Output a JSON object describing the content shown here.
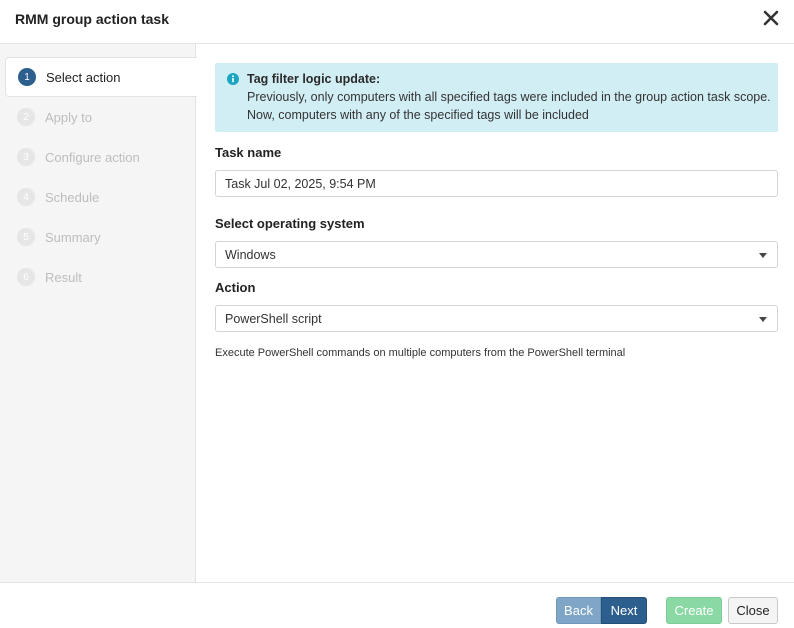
{
  "dialog": {
    "title": "RMM group action task",
    "close_icon": "close-x-icon"
  },
  "steps": [
    {
      "number": "1",
      "label": "Select action",
      "active": true
    },
    {
      "number": "2",
      "label": "Apply to",
      "active": false
    },
    {
      "number": "3",
      "label": "Configure action",
      "active": false
    },
    {
      "number": "4",
      "label": "Schedule",
      "active": false
    },
    {
      "number": "5",
      "label": "Summary",
      "active": false
    },
    {
      "number": "6",
      "label": "Result",
      "active": false
    }
  ],
  "alert": {
    "icon": "info-icon",
    "title": "Tag filter logic update:",
    "line1": "Previously, only computers with all specified tags were included in the group action task scope.",
    "line2": "Now, computers with any of the specified tags will be included"
  },
  "form": {
    "task_name_label": "Task name",
    "task_name_value": "Task Jul 02, 2025, 9:54 PM",
    "os_label": "Select operating system",
    "os_value": "Windows",
    "action_label": "Action",
    "action_value": "PowerShell script",
    "action_description": "Execute PowerShell commands on multiple computers from the PowerShell terminal"
  },
  "footer": {
    "back_label": "Back",
    "next_label": "Next",
    "create_label": "Create",
    "close_label": "Close"
  },
  "colors": {
    "primary": "#2c5f8e",
    "primary_disabled": "#7fa6c7",
    "success_disabled": "#8ad8a4",
    "alert_bg": "#d2eef5",
    "info_icon": "#1aa5c0",
    "sidebar_bg": "#f5f5f5"
  }
}
